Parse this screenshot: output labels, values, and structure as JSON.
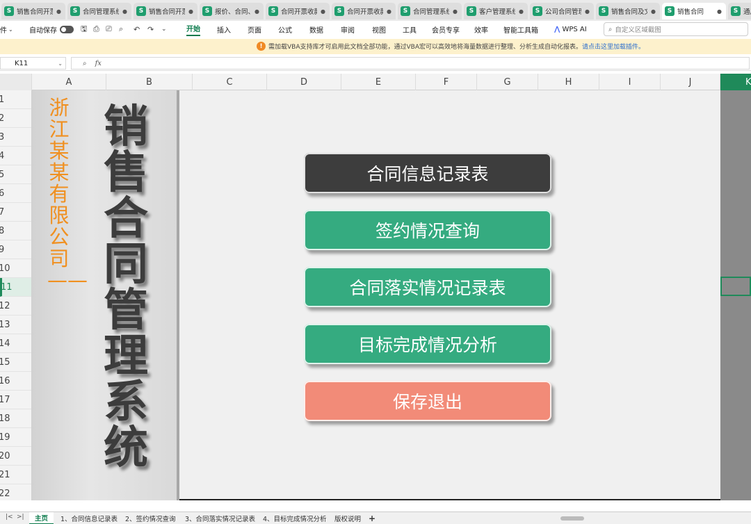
{
  "tabs": [
    {
      "label": "销售合同开票"
    },
    {
      "label": "合同管理系统"
    },
    {
      "label": "销售合同开票"
    },
    {
      "label": "报价、合同、"
    },
    {
      "label": "合同开票收款"
    },
    {
      "label": "合同开票收款"
    },
    {
      "label": "合同管理系统"
    },
    {
      "label": "客户管理系统"
    },
    {
      "label": "公司合同管理"
    },
    {
      "label": "销售合同及文"
    },
    {
      "label": "销售合同"
    },
    {
      "label": "通用"
    }
  ],
  "ribbon": {
    "file": "件",
    "autosave": "自动保存",
    "menus": [
      "开始",
      "插入",
      "页面",
      "公式",
      "数据",
      "审阅",
      "视图",
      "工具",
      "会员专享",
      "效率",
      "智能工具箱"
    ],
    "wps_ai": "WPS AI",
    "search_placeholder": "自定义区域截图"
  },
  "notice": {
    "text": "需加载VBA支持库才可启用此文档全部功能，通过VBA宏可以高效地将海量数据进行整理、分析生成自动化报表。",
    "link": "请点击这里加载插件。"
  },
  "formula_bar": {
    "cell_ref": "K11",
    "fx": "fx",
    "value": ""
  },
  "columns": [
    "A",
    "B",
    "C",
    "D",
    "E",
    "F",
    "G",
    "H",
    "I",
    "J",
    "K"
  ],
  "rows": [
    "1",
    "2",
    "3",
    "4",
    "5",
    "6",
    "7",
    "8",
    "9",
    "10",
    "11",
    "12",
    "13",
    "14",
    "15",
    "16",
    "17",
    "18",
    "19",
    "20",
    "21",
    "22"
  ],
  "selected_column": "K",
  "selected_row": "11",
  "dashboard": {
    "company": "浙江某某有限公司——",
    "title": "销售合同管理系统",
    "buttons": [
      {
        "label": "合同信息记录表",
        "color": "#3d3d3d"
      },
      {
        "label": "签约情况查询",
        "color": "#35ab80"
      },
      {
        "label": "合同落实情况记录表",
        "color": "#35ab80"
      },
      {
        "label": "目标完成情况分析",
        "color": "#35ab80"
      },
      {
        "label": "保存退出",
        "color": "#f28b78"
      }
    ]
  },
  "sheet_tabs": [
    "主页",
    "1、合同信息记录表",
    "2、签约情况查询",
    "3、合同落实情况记录表",
    "4、目标完成情况分析",
    "版权说明"
  ],
  "add_sheet": "+"
}
